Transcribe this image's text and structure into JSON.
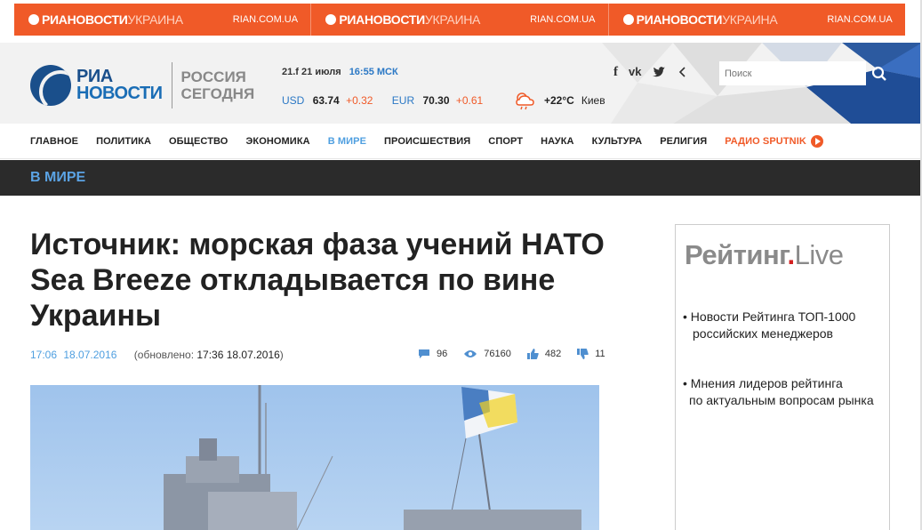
{
  "ad_banner": {
    "cells": [
      {
        "brand_bold": "РИАНОВОСТИ",
        "brand_light": "УКРАИНА",
        "site": "RIAN.COM.UA"
      },
      {
        "brand_bold": "РИАНОВОСТИ",
        "brand_light": "УКРАИНА",
        "site": "RIAN.COM.UA"
      },
      {
        "brand_bold": "РИАНОВОСТИ",
        "brand_light": "УКРАИНА",
        "site": "RIAN.COM.UA"
      }
    ]
  },
  "header": {
    "logo_line1": "РИА",
    "logo_line2": "НОВОСТИ",
    "partner_line1": "РОССИЯ",
    "partner_line2": "СЕГОДНЯ",
    "date_prefix": "21.f",
    "date": "21 июля",
    "time": "16:55 МСК",
    "rates": [
      {
        "currency": "USD",
        "value": "63.74",
        "change": "+0.32"
      },
      {
        "currency": "EUR",
        "value": "70.30",
        "change": "+0.61"
      }
    ],
    "weather_temp": "+22°C",
    "weather_city": "Киев",
    "social": [
      "f",
      "vk",
      "tw",
      "<"
    ],
    "search_placeholder": "Поиск"
  },
  "nav": {
    "items": [
      "ГЛАВНОЕ",
      "ПОЛИТИКА",
      "ОБЩЕСТВО",
      "ЭКОНОМИКА",
      "В МИРЕ",
      "ПРОИСШЕСТВИЯ",
      "СПОРТ",
      "НАУКА",
      "КУЛЬТУРА",
      "РЕЛИГИЯ"
    ],
    "radio": "РАДИО SPUTNIK"
  },
  "section": {
    "title": "В МИРЕ"
  },
  "article": {
    "headline": "Источник: морская фаза учений НАТО Sea Breeze откладывается по вине Украины",
    "time": "17:06",
    "date": "18.07.2016",
    "updated_prefix": "(обновлено: ",
    "updated_value": "17:36 18.07.2016",
    "updated_suffix": ")",
    "comments": "96",
    "views": "76160",
    "likes": "482",
    "dislikes": "11"
  },
  "sidebar": {
    "logo_main": "Рейтинг",
    "logo_dot": ".",
    "logo_live": "Live",
    "links": [
      {
        "line1": "• Новости Рейтинга ТОП-1000",
        "line2": "российских менеджеров"
      },
      {
        "line1": "• Мнения лидеров рейтинга",
        "line2": "по актуальным вопросам рынка"
      }
    ]
  },
  "colors": {
    "accent_orange": "#f05a28",
    "link_blue": "#4f9fe0",
    "section_bar": "#2b2b2b",
    "logo_blue": "#1a4f8b"
  }
}
